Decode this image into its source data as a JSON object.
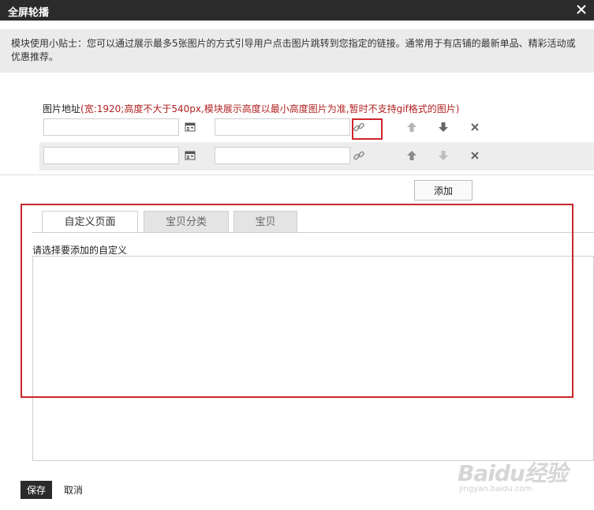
{
  "dialog": {
    "title": "全屏轮播"
  },
  "tip": {
    "text": "模块使用小贴士：您可以通过展示最多5张图片的方式引导用户点击图片跳转到您指定的链接。通常用于有店铺的最新单品、精彩活动或优惠推荐。"
  },
  "image_address": {
    "label": "图片地址",
    "note": "(宽:1920;高度不大于540px,模块展示高度以最小高度图片为准,暂时不支持gif格式的图片)"
  },
  "rows": [
    {
      "image_url": "",
      "link_url": ""
    },
    {
      "image_url": "",
      "link_url": ""
    }
  ],
  "buttons": {
    "add": "添加",
    "save": "保存",
    "cancel": "取消"
  },
  "tabs": [
    {
      "label": "自定义页面",
      "active": true
    },
    {
      "label": "宝贝分类",
      "active": false
    },
    {
      "label": "宝贝",
      "active": false
    }
  ],
  "content": {
    "select_label": "请选择要添加的自定义"
  },
  "watermark": {
    "logo": "Baidu经验",
    "url": "jingyan.baidu.com"
  },
  "colors": {
    "titlebar": "#2b2b2b",
    "highlight": "#d0262b",
    "note": "#b22222",
    "tip_bg": "#ebebeb"
  },
  "icons": [
    "close-icon",
    "image-picker-icon",
    "link-icon",
    "arrow-up-icon",
    "arrow-down-icon",
    "delete-icon"
  ]
}
